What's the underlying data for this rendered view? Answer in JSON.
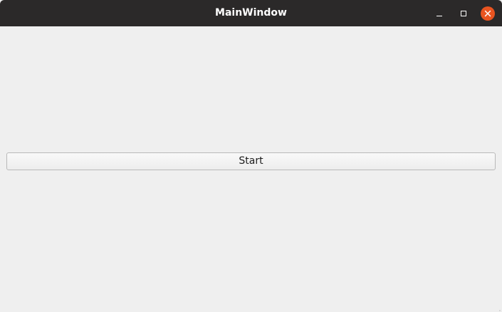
{
  "window": {
    "title": "MainWindow",
    "controls": {
      "minimize_icon": "minimize-icon",
      "maximize_icon": "maximize-icon",
      "close_icon": "close-icon"
    },
    "accent_color": "#e95420",
    "titlebar_color": "#2b2929"
  },
  "main": {
    "start_label": "Start"
  }
}
